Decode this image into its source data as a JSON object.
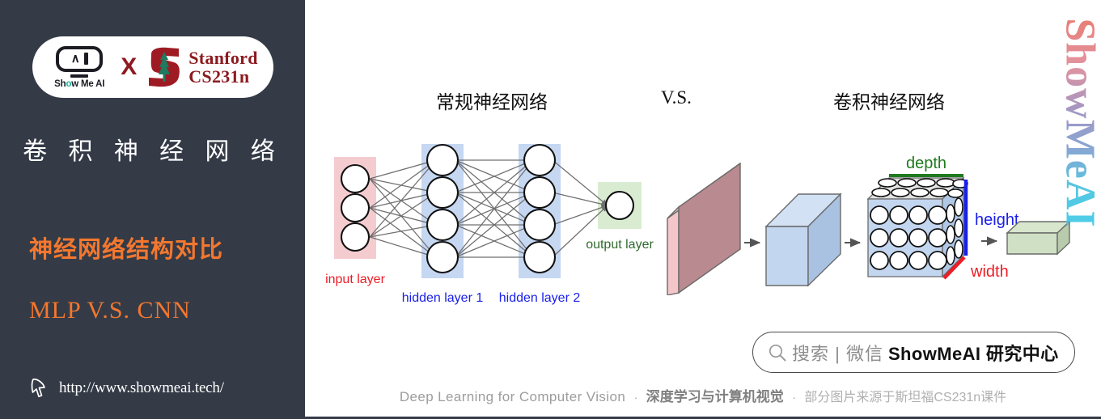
{
  "sidebar": {
    "badge": {
      "brand_name": "Show Me AI",
      "brand_o": "o",
      "brand_pre": "Sh",
      "brand_post": "w Me AI",
      "cross": "X",
      "partner_line1": "Stanford",
      "partner_line2": "CS231n"
    },
    "title": "卷 积 神 经 网 络",
    "subtitle": "神经网络结构对比",
    "subtitle_en": "MLP V.S. CNN",
    "url": "http://www.showmeai.tech/",
    "bg_color": "#343b47",
    "accent_color": "#f4772e"
  },
  "main": {
    "titles": {
      "left": "常规神经网络",
      "middle": "V.S.",
      "right": "卷积神经网络"
    },
    "mlp": {
      "input_label": "input layer",
      "hidden1_label": "hidden layer 1",
      "hidden2_label": "hidden layer 2",
      "output_label": "output layer",
      "input_nodes": 3,
      "hidden1_nodes": 4,
      "hidden2_nodes": 4,
      "output_nodes": 1,
      "input_color": "#f3c9cd",
      "hidden_color": "#c3d6f0",
      "output_color": "#d6ebcf",
      "input_label_color": "#ee1c25",
      "hidden_label_color": "#1a20e8",
      "output_label_color": "#2f6b2f"
    },
    "cnn": {
      "depth_label": "depth",
      "height_label": "height",
      "width_label": "width",
      "depth_color": "#1f7a1f",
      "height_color": "#1a20e8",
      "width_color": "#ee1c25",
      "slab_color": "#b98a8f",
      "cube_color": "#c3d6f0",
      "output_color": "#cfe0c5"
    },
    "watermark": "ShowMeAI",
    "search": {
      "icon": "search-icon",
      "grey_text": "搜索 | 微信",
      "bold_text": "ShowMeAI 研究中心"
    },
    "footer": {
      "english": "Deep Learning for Computer Vision",
      "separator": "·",
      "chinese_bold": "深度学习与计算机视觉",
      "chinese_note": "部分图片来源于斯坦福CS231n课件"
    }
  }
}
